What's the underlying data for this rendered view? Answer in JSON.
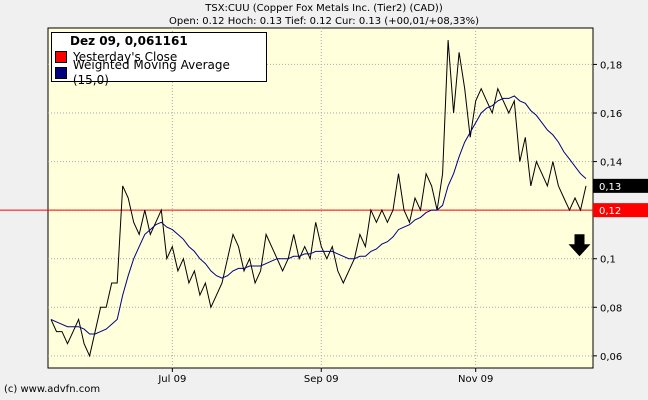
{
  "header": {
    "line1": "TSX:CUU (Copper Fox Metals Inc. (Tier2) (CAD))",
    "line2": "Open: 0.12 Hoch: 0.13 Tief: 0.12 Cur: 0.13 (+00,01/+08,33%)"
  },
  "copyright": "(c) www.advfn.com",
  "legend": {
    "header": "Dez 09, 0,061161",
    "items": [
      {
        "label": "Yesterday's Close",
        "color": "#ff0000"
      },
      {
        "label": "Weighted Moving Average (15,0)",
        "color": "#000080"
      }
    ]
  },
  "chart_data": {
    "type": "line",
    "ylim": [
      0.055,
      0.195
    ],
    "yticks": [
      {
        "value": 0.06,
        "label": "0,06"
      },
      {
        "value": 0.08,
        "label": "0,08"
      },
      {
        "value": 0.1,
        "label": "0,1"
      },
      {
        "value": 0.12,
        "label": "0,12"
      },
      {
        "value": 0.14,
        "label": "0,14"
      },
      {
        "value": 0.16,
        "label": "0,16"
      },
      {
        "value": 0.18,
        "label": "0,18"
      }
    ],
    "xticks": [
      {
        "index": 22,
        "label": "Jul 09"
      },
      {
        "index": 49,
        "label": "Sep 09"
      },
      {
        "index": 77,
        "label": "Nov 09"
      }
    ],
    "reference_line": {
      "value": 0.12,
      "label": "0,12",
      "color": "#ff0000"
    },
    "current_value": {
      "value": 0.13,
      "label": "0,13"
    },
    "grid": true,
    "arrow_color": "#000000",
    "series": [
      {
        "color": "#000000",
        "values": [
          0.075,
          0.07,
          0.07,
          0.065,
          0.07,
          0.075,
          0.065,
          0.06,
          0.07,
          0.08,
          0.08,
          0.09,
          0.09,
          0.13,
          0.125,
          0.115,
          0.11,
          0.12,
          0.11,
          0.115,
          0.12,
          0.1,
          0.105,
          0.095,
          0.1,
          0.09,
          0.095,
          0.085,
          0.09,
          0.08,
          0.085,
          0.09,
          0.1,
          0.11,
          0.105,
          0.095,
          0.1,
          0.09,
          0.095,
          0.11,
          0.105,
          0.1,
          0.095,
          0.1,
          0.11,
          0.1,
          0.105,
          0.1,
          0.115,
          0.105,
          0.1,
          0.105,
          0.095,
          0.09,
          0.095,
          0.1,
          0.11,
          0.105,
          0.12,
          0.115,
          0.12,
          0.115,
          0.12,
          0.135,
          0.12,
          0.115,
          0.125,
          0.12,
          0.135,
          0.13,
          0.12,
          0.135,
          0.19,
          0.16,
          0.185,
          0.17,
          0.15,
          0.165,
          0.17,
          0.165,
          0.16,
          0.17,
          0.165,
          0.16,
          0.165,
          0.14,
          0.15,
          0.13,
          0.14,
          0.135,
          0.13,
          0.14,
          0.13,
          0.125,
          0.12,
          0.125,
          0.12,
          0.13
        ]
      },
      {
        "color": "#000080",
        "values": [
          0.075,
          0.074,
          0.073,
          0.072,
          0.072,
          0.072,
          0.071,
          0.069,
          0.069,
          0.07,
          0.071,
          0.073,
          0.075,
          0.085,
          0.093,
          0.1,
          0.105,
          0.11,
          0.112,
          0.114,
          0.115,
          0.113,
          0.112,
          0.11,
          0.108,
          0.105,
          0.103,
          0.1,
          0.098,
          0.095,
          0.093,
          0.092,
          0.093,
          0.095,
          0.096,
          0.096,
          0.097,
          0.097,
          0.097,
          0.098,
          0.099,
          0.1,
          0.1,
          0.1,
          0.101,
          0.101,
          0.102,
          0.102,
          0.103,
          0.103,
          0.103,
          0.103,
          0.102,
          0.101,
          0.1,
          0.1,
          0.101,
          0.101,
          0.103,
          0.104,
          0.106,
          0.107,
          0.109,
          0.112,
          0.113,
          0.114,
          0.116,
          0.117,
          0.119,
          0.12,
          0.12,
          0.122,
          0.13,
          0.135,
          0.142,
          0.148,
          0.152,
          0.156,
          0.16,
          0.162,
          0.163,
          0.165,
          0.166,
          0.166,
          0.167,
          0.165,
          0.164,
          0.161,
          0.159,
          0.156,
          0.153,
          0.151,
          0.148,
          0.144,
          0.141,
          0.138,
          0.135,
          0.133
        ]
      }
    ]
  }
}
